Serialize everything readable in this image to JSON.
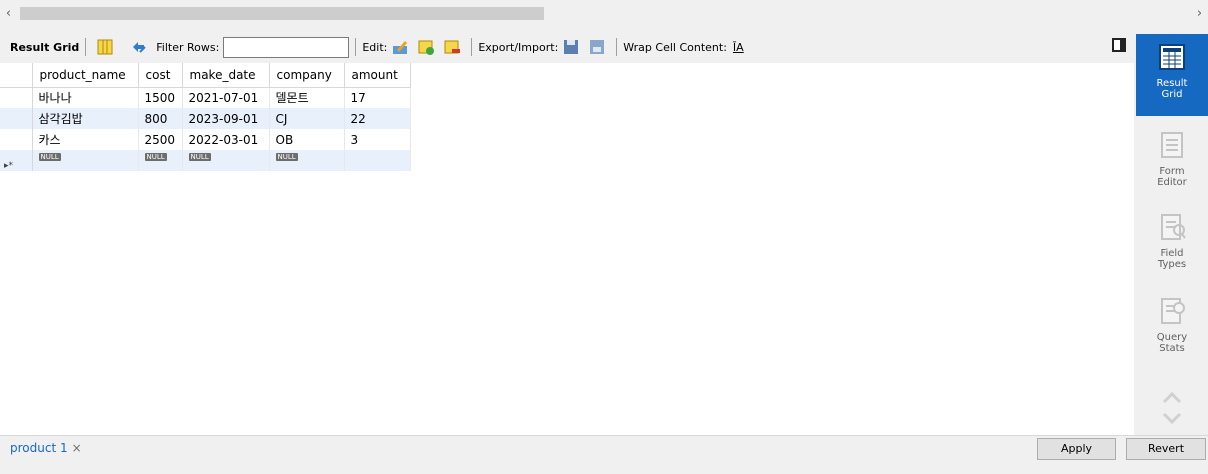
{
  "scrollbar": {
    "left_arrow": "‹",
    "right_arrow": "›"
  },
  "toolbar": {
    "result_grid": "Result Grid",
    "filter_rows": "Filter Rows:",
    "filter_value": "",
    "edit": "Edit:",
    "export_import": "Export/Import:",
    "wrap_cell": "Wrap Cell Content:",
    "wrap_icon_text": "ĪA"
  },
  "grid": {
    "columns": [
      "product_name",
      "cost",
      "make_date",
      "company",
      "amount"
    ],
    "rows": [
      [
        "바나나",
        "1500",
        "2021-07-01",
        "델몬트",
        "17"
      ],
      [
        "삼각김밥",
        "800",
        "2023-09-01",
        "CJ",
        "22"
      ],
      [
        "카스",
        "2500",
        "2022-03-01",
        "OB",
        "3"
      ]
    ],
    "new_row_marker": "▸*",
    "null_label": "NULL"
  },
  "sidebar": {
    "result_grid": [
      "Result",
      "Grid"
    ],
    "form_editor": [
      "Form",
      "Editor"
    ],
    "field_types": [
      "Field",
      "Types"
    ],
    "query_stats": [
      "Query",
      "Stats"
    ]
  },
  "bottom": {
    "tab_label": "product 1",
    "tab_close": "×",
    "apply": "Apply",
    "revert": "Revert"
  },
  "colors": {
    "accent": "#1669c0",
    "alt_row": "#e8f0fb"
  }
}
